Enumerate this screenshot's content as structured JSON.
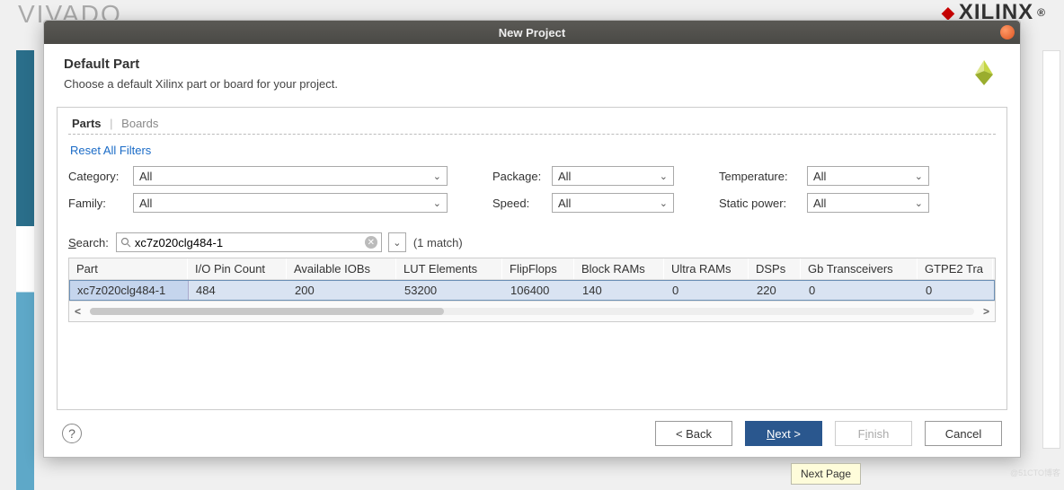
{
  "background": {
    "vivado": "VIVADO",
    "xilinx": "XILINX"
  },
  "dialog": {
    "title": "New Project",
    "heading": "Default Part",
    "subheading": "Choose a default Xilinx part or board for your project."
  },
  "tabs": {
    "parts": "Parts",
    "boards": "Boards"
  },
  "reset_link": "Reset All Filters",
  "filters": {
    "category": {
      "label": "Category:",
      "value": "All"
    },
    "family": {
      "label": "Family:",
      "value": "All"
    },
    "package": {
      "label": "Package:",
      "value": "All"
    },
    "speed": {
      "label": "Speed:",
      "value": "All"
    },
    "temperature": {
      "label": "Temperature:",
      "value": "All"
    },
    "static_power": {
      "label": "Static power:",
      "value": "All"
    }
  },
  "search": {
    "label": "Search:",
    "value": "xc7z020clg484-1",
    "match_text": "(1 match)"
  },
  "table": {
    "headers": {
      "part": "Part",
      "io_pin": "I/O Pin Count",
      "iobs": "Available IOBs",
      "lut": "LUT Elements",
      "ff": "FlipFlops",
      "bram": "Block RAMs",
      "uram": "Ultra RAMs",
      "dsp": "DSPs",
      "gbt": "Gb Transceivers",
      "gtpe2": "GTPE2 Tra"
    },
    "row": {
      "part": "xc7z020clg484-1",
      "io_pin": "484",
      "iobs": "200",
      "lut": "53200",
      "ff": "106400",
      "bram": "140",
      "uram": "0",
      "dsp": "220",
      "gbt": "0",
      "gtpe2": "0"
    }
  },
  "buttons": {
    "back": "< Back",
    "next_pre": "N",
    "next_post": "ext >",
    "finish_pre": "F",
    "finish_post": "inish",
    "cancel": "Cancel"
  },
  "tooltip": "Next Page",
  "help_char": "?",
  "watermark": "@51CTO博客"
}
